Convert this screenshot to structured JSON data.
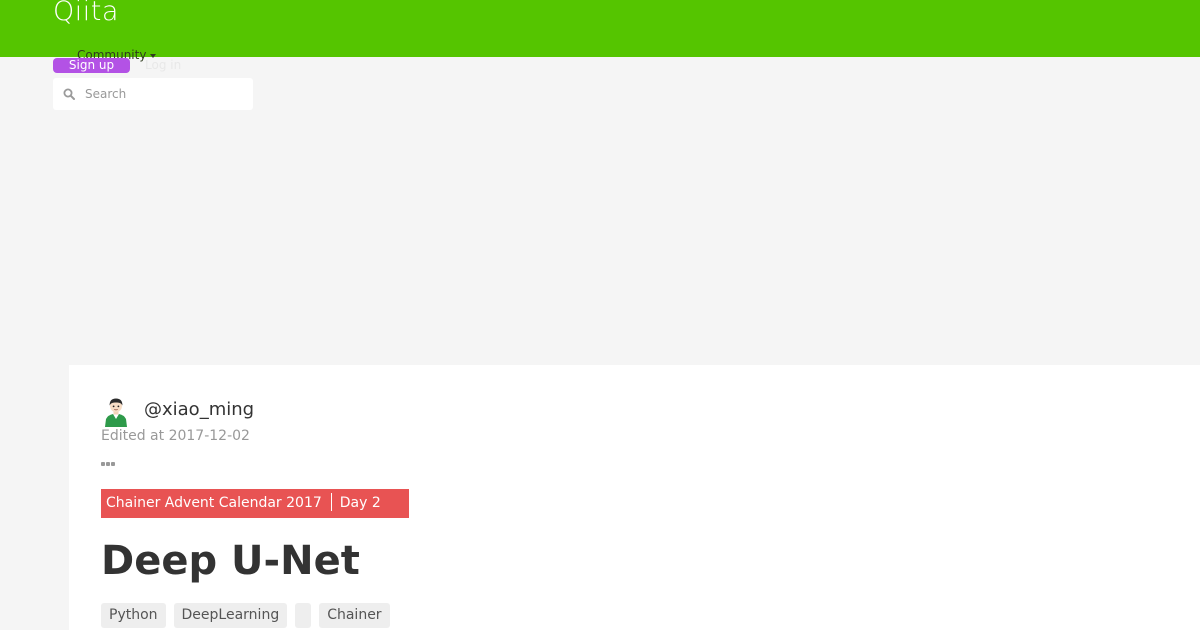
{
  "header": {
    "logo": "Qiita",
    "community_label": "Community",
    "signup_label": "Sign up",
    "login_label": "Log in",
    "search": {
      "placeholder": "Search"
    },
    "colors": {
      "bar": "#55c500",
      "signup": "#b352e5"
    }
  },
  "article": {
    "username": "@xiao_ming",
    "edited": "Edited at 2017-12-02",
    "more_icon": "ellipsis-icon",
    "calendar": {
      "name": "Chainer Advent Calendar 2017",
      "day": "Day 2",
      "color": "#e85353"
    },
    "title": "Deep U-Net",
    "tags": [
      {
        "label": "Python"
      },
      {
        "label": "DeepLearning"
      },
      {
        "label": ""
      },
      {
        "label": "Chainer"
      }
    ]
  }
}
